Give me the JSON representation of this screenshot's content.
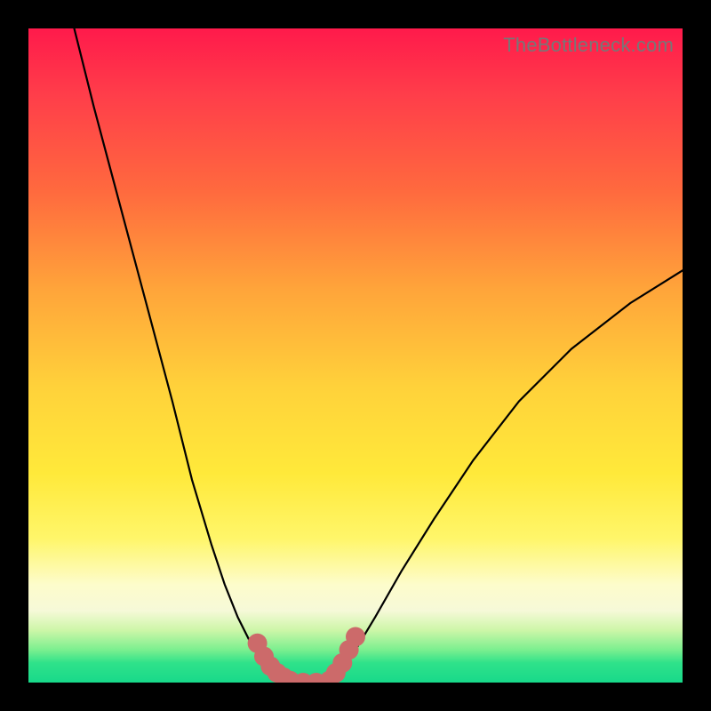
{
  "watermark": "TheBottleneck.com",
  "chart_data": {
    "type": "line",
    "title": "",
    "xlabel": "",
    "ylabel": "",
    "xlim": [
      0,
      100
    ],
    "ylim": [
      0,
      100
    ],
    "grid": false,
    "series": [
      {
        "name": "left-curve",
        "x": [
          7,
          10,
          14,
          18,
          22,
          25,
          28,
          30,
          32,
          34,
          36,
          37,
          38,
          39,
          40
        ],
        "y": [
          100,
          88,
          73,
          58,
          43,
          31,
          21,
          15,
          10,
          6,
          3,
          2,
          1,
          0.5,
          0
        ]
      },
      {
        "name": "right-curve",
        "x": [
          46,
          48,
          50,
          53,
          57,
          62,
          68,
          75,
          83,
          92,
          100
        ],
        "y": [
          0,
          2,
          5,
          10,
          17,
          25,
          34,
          43,
          51,
          58,
          63
        ]
      },
      {
        "name": "flat-min",
        "x": [
          40,
          46
        ],
        "y": [
          0,
          0
        ]
      }
    ],
    "markers": {
      "name": "highlighted-region",
      "points": [
        {
          "x": 35,
          "y": 6
        },
        {
          "x": 36,
          "y": 4
        },
        {
          "x": 37,
          "y": 2.5
        },
        {
          "x": 38,
          "y": 1.5
        },
        {
          "x": 39,
          "y": 0.8
        },
        {
          "x": 40,
          "y": 0.3
        },
        {
          "x": 42,
          "y": 0
        },
        {
          "x": 44,
          "y": 0
        },
        {
          "x": 46,
          "y": 0.3
        },
        {
          "x": 47,
          "y": 1.5
        },
        {
          "x": 48,
          "y": 3
        },
        {
          "x": 49,
          "y": 5
        },
        {
          "x": 50,
          "y": 7
        }
      ]
    },
    "gradient_colors": {
      "top": "#ff1a4b",
      "mid_upper": "#ffa53a",
      "mid": "#ffe93a",
      "mid_lower": "#fdfccb",
      "bottom": "#18d98a"
    }
  }
}
